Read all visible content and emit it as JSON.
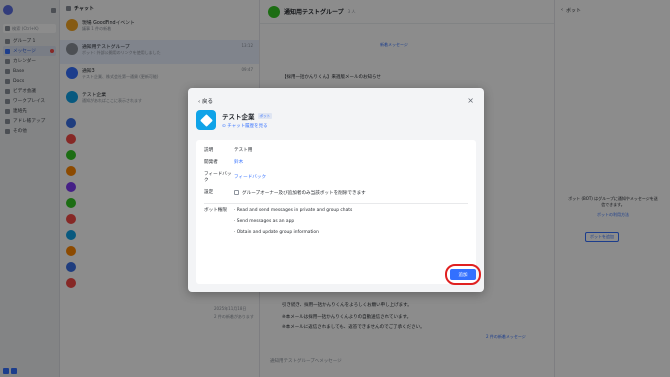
{
  "sidebar": {
    "search_placeholder": "検索 (Ctrl+K)",
    "items": [
      {
        "label": "グループ 1"
      },
      {
        "label": "メッセージ"
      },
      {
        "label": "カレンダー"
      },
      {
        "label": "Base"
      },
      {
        "label": "Docs"
      },
      {
        "label": "ビデオ会議"
      },
      {
        "label": "ワークプレイス"
      },
      {
        "label": "連絡先"
      },
      {
        "label": "アドレ帳アップ"
      },
      {
        "label": "その他"
      }
    ]
  },
  "chat_list": {
    "header": "チャット",
    "chats": [
      {
        "title": "現場 GoodFindイベント",
        "sub": "議事 1 件の新着",
        "time": ""
      },
      {
        "title": "通知用テストグループ",
        "sub": "ボット: 外部公開用のリンクを使用しました",
        "time": "13:12"
      },
      {
        "title": "通知3",
        "sub": "テスト企業、株式会社第一通貨 (更新可能)",
        "time": "09:47"
      },
      {
        "title": "テスト企業",
        "sub": "通知があればここに表示されます",
        "time": "2/10"
      }
    ],
    "date_label": "2025年11月18日",
    "date_sub": "2 件の新着があります"
  },
  "main": {
    "title": "通知用テストグループ",
    "members": "3 人",
    "new_message_divider": "新着メッセージ",
    "message_preview": "【採用一括かんりくん】来週版メールのお知らせ",
    "body_lines": [
      "引き続き、採用一括かんりくんをよろしくお願い申し上げます。",
      "※本メールは採用一括かんりくんよりの自動送信されています。",
      "※本メールに返信されましても、返答できませんのでご了承ください。"
    ],
    "jump_link": "2 件の新着メッセージ",
    "input_placeholder": "通知用テストグループへメッセージ"
  },
  "right_panel": {
    "title": "ボット",
    "description": "ボット (BOT) はグループに通知やメッセージを送信できます。",
    "link": "ボットの利用方法",
    "add_button": "ボットを追加"
  },
  "modal": {
    "back_label": "戻る",
    "bot_name": "テスト企業",
    "bot_tag": "ボット",
    "history_link": "チャット履歴を見る",
    "fields": {
      "desc_label": "説明",
      "desc_value": "テスト用",
      "dev_label": "開発者",
      "dev_value": "鈴木",
      "feedback_label": "フィードバック",
      "feedback_value": "フィードバック",
      "settings_label": "設定",
      "settings_value": "グループオーナー及び追加者のみ当該ボットを削除できます",
      "perm_label": "ボット権限"
    },
    "permissions": [
      "Read and send messages in private and group chats",
      "Send messages as an app",
      "Obtain and update group information"
    ],
    "add_button": "追加"
  },
  "colors": {
    "accent": "#3370ff",
    "highlight_ring": "#e02020",
    "bot_icon": "#0fa3e8"
  }
}
